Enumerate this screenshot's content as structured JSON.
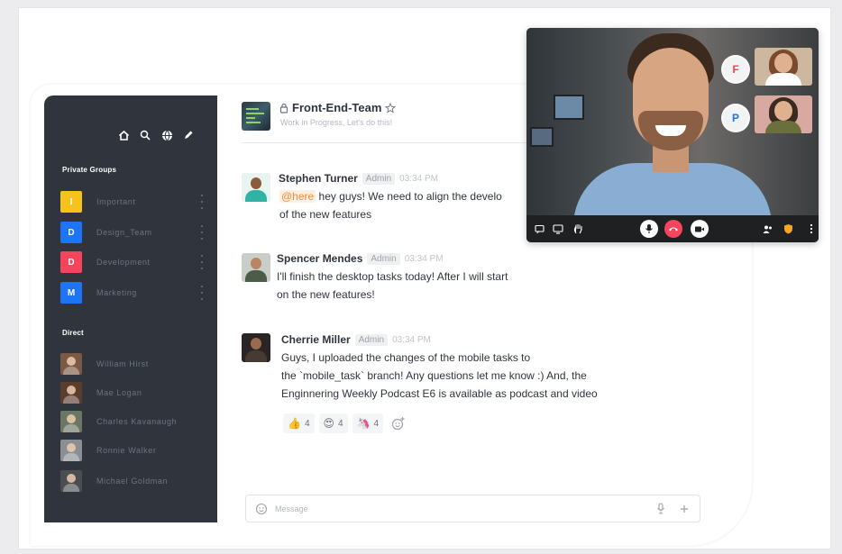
{
  "sidebar": {
    "private_groups_title": "Private Groups",
    "groups": [
      {
        "initial": "I",
        "label": "Important",
        "color": "#f5c31b"
      },
      {
        "initial": "D",
        "label": "Design_Team",
        "color": "#1d74f5"
      },
      {
        "initial": "D",
        "label": "Development",
        "color": "#f5455c"
      },
      {
        "initial": "M",
        "label": "Marketing",
        "color": "#1d74f5"
      }
    ],
    "direct_title": "Direct",
    "direct": [
      {
        "name": "William Hirst"
      },
      {
        "name": "Mae Logan"
      },
      {
        "name": "Charles Kavanaugh"
      },
      {
        "name": "Ronnie Walker"
      },
      {
        "name": "Michael Goldman"
      }
    ]
  },
  "channel": {
    "name": "Front-End-Team",
    "topic": "Work in Progress, Let's do this!"
  },
  "messages": [
    {
      "author": "Stephen Turner",
      "role": "Admin",
      "time": "03:34 PM",
      "mention": "@here",
      "line1": " hey guys! We need to align the develo",
      "line2": "of the new features"
    },
    {
      "author": "Spencer Mendes",
      "role": "Admin",
      "time": "03:34 PM",
      "line1": "I'll finish the desktop tasks today! After I will start",
      "line2": "on the new features!"
    },
    {
      "author": "Cherrie Miller",
      "role": "Admin",
      "time": "03:34 PM",
      "line1": "Guys, I uploaded the changes of the mobile tasks to",
      "line2": "the `mobile_task` branch! Any questions let me know :) And, the",
      "line3": "Enginnering Weekly Podcast E6 is available as podcast and video"
    }
  ],
  "reactions": [
    {
      "emoji": "👍",
      "count": "4"
    },
    {
      "emoji": "😍",
      "count": "4"
    },
    {
      "emoji": "🦄",
      "count": "4"
    }
  ],
  "composer": {
    "placeholder": "Message"
  },
  "video_call": {
    "participants": [
      {
        "initial": "F",
        "color": "#f5455c"
      },
      {
        "initial": "P",
        "color": "#1d74f5"
      }
    ],
    "hangup_color": "#f5455c",
    "control_icons": [
      "chat-icon",
      "screen-share-icon",
      "raise-hand-icon",
      "microphone-icon",
      "hangup-icon",
      "camera-icon",
      "participants-icon",
      "shield-icon",
      "more-icon"
    ]
  },
  "colors": {
    "sidebar_bg": "#2f343d",
    "accent": "#1d74f5",
    "mention": "#f38c39"
  }
}
